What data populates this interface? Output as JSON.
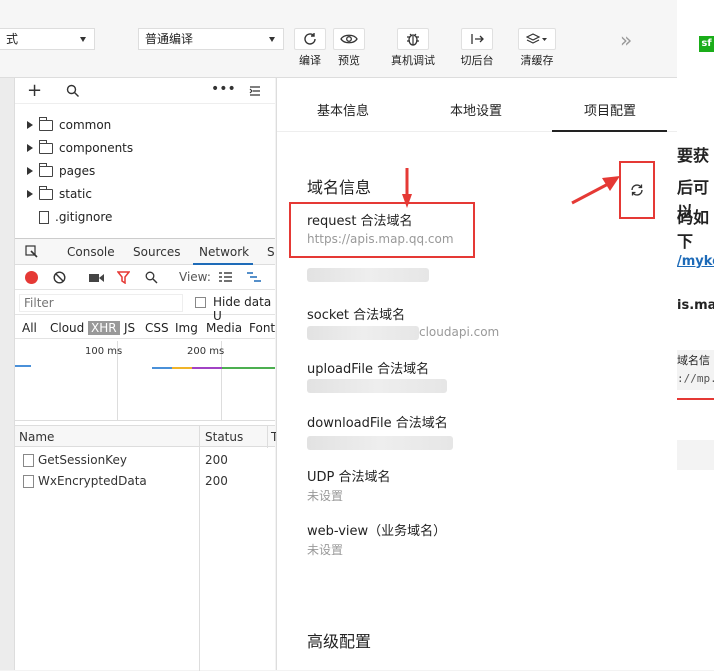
{
  "toolbar": {
    "mode_select": "式",
    "compile_select": "普通编译",
    "buttons": [
      {
        "label": "编译",
        "icon": "refresh-icon"
      },
      {
        "label": "预览",
        "icon": "eye-icon"
      },
      {
        "label": "真机调试",
        "icon": "bug-icon"
      },
      {
        "label": "切后台",
        "icon": "switch-background-icon"
      },
      {
        "label": "清缓存",
        "icon": "layers-icon"
      }
    ],
    "more": "»"
  },
  "filetree": {
    "items": [
      {
        "name": "common",
        "type": "folder"
      },
      {
        "name": "components",
        "type": "folder"
      },
      {
        "name": "pages",
        "type": "folder"
      },
      {
        "name": "static",
        "type": "folder"
      },
      {
        "name": ".gitignore",
        "type": "file"
      }
    ]
  },
  "devtools": {
    "tabs": [
      "Console",
      "Sources",
      "Network",
      "S"
    ],
    "view_label": "View:",
    "filter_placeholder": "Filter",
    "hide_data": "Hide data U",
    "types": [
      "All",
      "Cloud",
      "XHR",
      "JS",
      "CSS",
      "Img",
      "Media",
      "Font"
    ],
    "timeline": [
      "100 ms",
      "200 ms"
    ],
    "columns": [
      "Name",
      "Status",
      "T"
    ],
    "rows": [
      {
        "name": "GetSessionKey",
        "status": "200"
      },
      {
        "name": "WxEncryptedData",
        "status": "200"
      }
    ]
  },
  "panel": {
    "tabs": [
      "基本信息",
      "本地设置",
      "项目配置"
    ],
    "active_tab": 2,
    "section_title": "域名信息",
    "fields": [
      {
        "label": "request 合法域名",
        "value": "https://apis.map.qq.com"
      },
      {
        "label": "socket 合法域名",
        "value": "cloudapi.com"
      },
      {
        "label": "uploadFile 合法域名",
        "value": ""
      },
      {
        "label": "downloadFile 合法域名",
        "value": ""
      },
      {
        "label": "UDP 合法域名",
        "value": "未设置"
      },
      {
        "label": "web-view（业务域名）",
        "value": "未设置"
      }
    ],
    "advanced_title": "高级配置"
  },
  "farright": {
    "badge": "sf",
    "lines": [
      "要获",
      "后可以",
      "码如下",
      "/myke",
      "is.ma",
      "域名信",
      "://mp."
    ]
  },
  "colors": {
    "accent_red": "#e53935",
    "green": "#1aad19",
    "link": "#1e6bb8"
  }
}
